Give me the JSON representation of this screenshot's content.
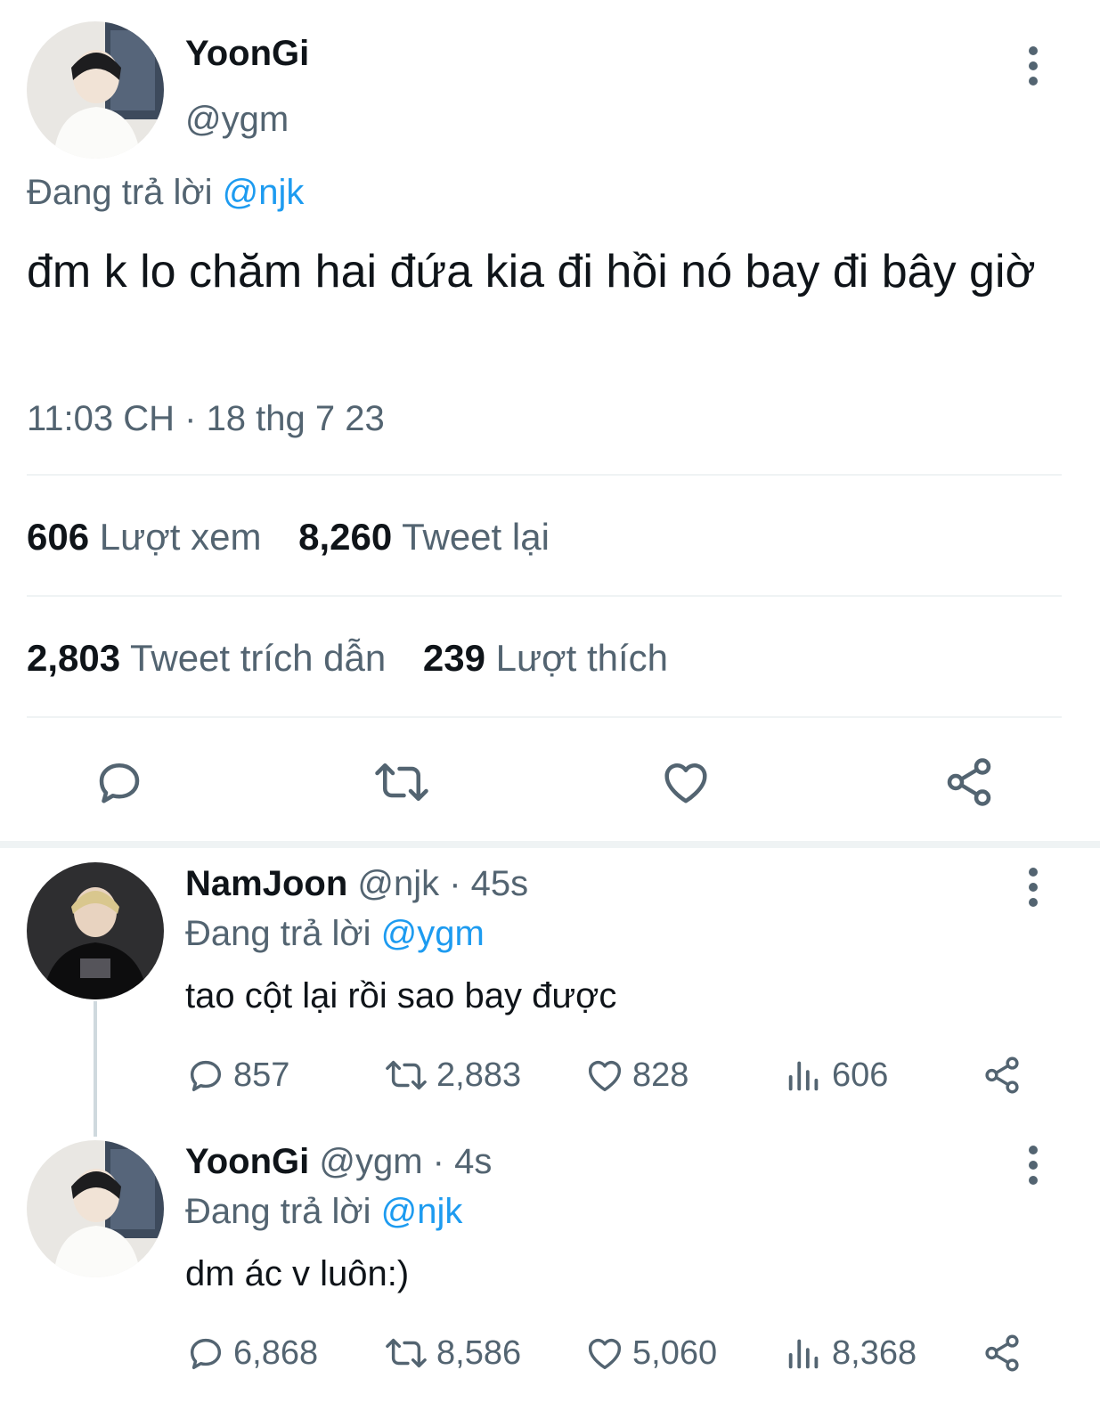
{
  "main_tweet": {
    "display_name": "YoonGi",
    "handle": "@ygm",
    "replying_prefix": "Đang trả lời",
    "replying_to": "@njk",
    "text": "đm k lo chăm hai đứa kia đi hồi nó bay đi bây giờ",
    "timestamp": "11:03 CH · 18 thg 7 23",
    "stats": {
      "views_count": "606",
      "views_label": "Lượt xem",
      "retweets_count": "8,260",
      "retweets_label": "Tweet lại",
      "quotes_count": "2,803",
      "quotes_label": "Tweet trích dẫn",
      "likes_count": "239",
      "likes_label": "Lượt thích"
    }
  },
  "replies": [
    {
      "display_name": "NamJoon",
      "meta": "@njk · 45s",
      "replying_prefix": "Đang trả lời",
      "replying_to": "@ygm",
      "text": "tao cột lại rồi sao bay được",
      "reply_count": "857",
      "retweet_count": "2,883",
      "like_count": "828",
      "view_count": "606"
    },
    {
      "display_name": "YoonGi",
      "meta": "@ygm · 4s",
      "replying_prefix": "Đang trả lời",
      "replying_to": "@njk",
      "text": "dm ác v luôn:)",
      "reply_count": "6,868",
      "retweet_count": "8,586",
      "like_count": "5,060",
      "view_count": "8,368"
    }
  ],
  "icons": {
    "reply": "reply-icon",
    "retweet": "retweet-icon",
    "like": "heart-icon",
    "share": "share-icon",
    "views": "views-icon",
    "more": "more-vertical-icon"
  },
  "colors": {
    "text": "#0f1419",
    "secondary": "#536471",
    "link": "#1d9bf0",
    "divider": "#eff3f4"
  }
}
